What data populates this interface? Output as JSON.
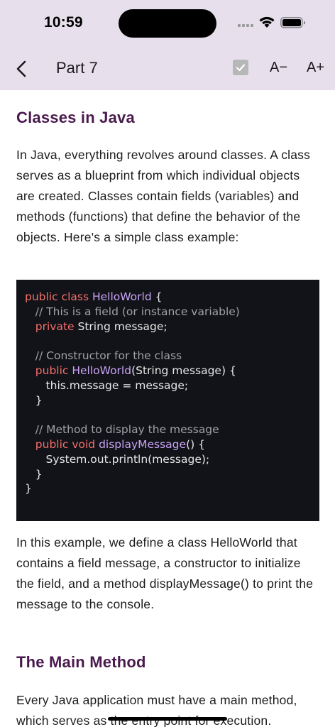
{
  "status": {
    "time": "10:59"
  },
  "header": {
    "title": "Part 7",
    "font_decrease": "A−",
    "font_increase": "A+"
  },
  "article": {
    "heading_classes": "Classes in Java",
    "para_intro": "In Java, everything revolves around classes. A class serves as a blueprint from which individual objects are created. Classes contain fields (variables) and methods (functions) that define the behavior of the objects. Here's a simple class example:",
    "para_explain": "In this example, we define a class HelloWorld that contains a field message, a constructor to initialize the field, and a method displayMessage() to print the message to the console.",
    "heading_main": "The Main Method",
    "para_main": "Every Java application must have a main method, which serves as the entry point for execution."
  },
  "code": {
    "l1_kw": "public class ",
    "l1_type": "HelloWorld",
    "l1_rest": " {",
    "l2_comment": "   // This is a field (or instance variable)",
    "l3_kw": "   private",
    "l3_rest": " String message;",
    "l5_comment": "   // Constructor for the class",
    "l6_kw": "   public ",
    "l6_type": "HelloWorld",
    "l6_rest": "(String message) {",
    "l7": "      this.message = message;",
    "l8": "   }",
    "l10_comment": "   // Method to display the message",
    "l11_kw": "   public void ",
    "l11_type": "displayMessage",
    "l11_rest": "() {",
    "l12": "      System.out.println(message);",
    "l13": "   }",
    "l14": "}"
  },
  "icons": {
    "back": "chevron-left-icon",
    "check": "checkbox-icon",
    "wifi": "wifi-icon",
    "battery": "battery-icon"
  }
}
